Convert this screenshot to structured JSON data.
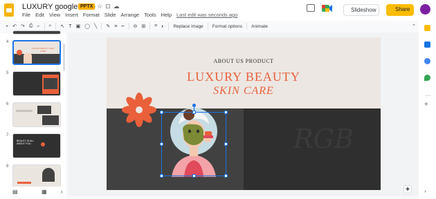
{
  "app": {
    "doc_title": "LUXURY google slide",
    "format_badge": "PPTX",
    "menus": [
      "File",
      "Edit",
      "View",
      "Insert",
      "Format",
      "Slide",
      "Arrange",
      "Tools",
      "Help"
    ],
    "last_edit": "Last edit was seconds ago",
    "slideshow_label": "Slideshow",
    "share_label": "Share"
  },
  "toolbar": {
    "replace_image": "Replace image",
    "format_options": "Format options",
    "animate": "Animate"
  },
  "filmstrip": {
    "slides": [
      {
        "num": "4",
        "title": "LUXURY BEAUTY SKIN CARE",
        "selected": true
      },
      {
        "num": "5",
        "title": "",
        "selected": false
      },
      {
        "num": "6",
        "title": "",
        "selected": false
      },
      {
        "num": "7",
        "title": "BEAUTY IS ALL ABOUT YOU",
        "selected": false
      },
      {
        "num": "8",
        "title": "",
        "selected": false
      }
    ]
  },
  "slide": {
    "kicker": "ABOUT US PRODUCT",
    "title_line1": "LUXURY BEAUTY",
    "title_line2": "SKIN CARE",
    "watermark": "RGB",
    "accent_color": "#e9603a"
  }
}
